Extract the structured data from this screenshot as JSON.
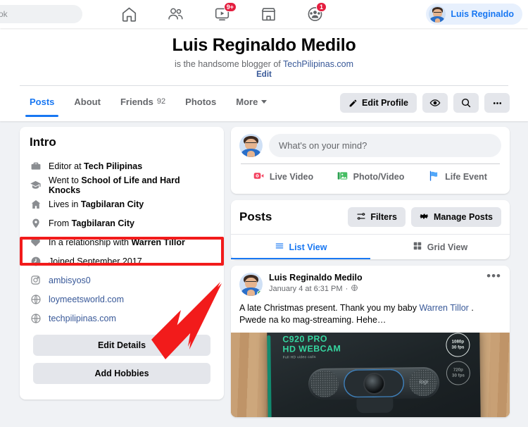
{
  "topnav": {
    "search_placeholder": "ok",
    "icons": [
      {
        "name": "home-icon",
        "label": "Home",
        "badge": ""
      },
      {
        "name": "friends-icon",
        "label": "Friends",
        "badge": ""
      },
      {
        "name": "watch-icon",
        "label": "Watch",
        "badge": "9+"
      },
      {
        "name": "marketplace-icon",
        "label": "Marketplace",
        "badge": ""
      },
      {
        "name": "groups-icon",
        "label": "Groups",
        "badge": "1"
      }
    ],
    "user_chip_name": "Luis Reginaldo"
  },
  "profile": {
    "name": "Luis Reginaldo Medilo",
    "bio_prefix": "is the handsome blogger of ",
    "bio_link": "TechPilipinas.com",
    "edit_label": "Edit",
    "tabs": [
      {
        "label": "Posts",
        "count": "",
        "active": true
      },
      {
        "label": "About",
        "count": "",
        "active": false
      },
      {
        "label": "Friends",
        "count": "92",
        "active": false
      },
      {
        "label": "Photos",
        "count": "",
        "active": false
      },
      {
        "label": "More",
        "count": "",
        "active": false
      }
    ],
    "actions": {
      "edit_profile": "Edit Profile",
      "view_as": "view-as-eye-icon",
      "search": "search-icon",
      "more": "more-options-icon"
    }
  },
  "intro": {
    "title": "Intro",
    "rows": [
      {
        "icon": "briefcase-icon",
        "prefix": "Editor at ",
        "bold": "Tech Pilipinas",
        "link": false
      },
      {
        "icon": "graduation-cap-icon",
        "prefix": "Went to ",
        "bold": "School of Life and Hard Knocks",
        "link": false
      },
      {
        "icon": "home-icon",
        "prefix": "Lives in ",
        "bold": "Tagbilaran City",
        "link": false
      },
      {
        "icon": "location-pin-icon",
        "prefix": "From ",
        "bold": "Tagbilaran City",
        "link": false
      },
      {
        "icon": "heart-icon",
        "prefix": "In a relationship with ",
        "bold": "Warren Tillor",
        "link": false
      },
      {
        "icon": "clock-icon",
        "prefix": "Joined September 2017",
        "bold": "",
        "link": false
      },
      {
        "icon": "instagram-icon",
        "prefix": "ambisyos0",
        "bold": "",
        "link": true
      },
      {
        "icon": "globe-icon",
        "prefix": "loymeetsworld.com",
        "bold": "",
        "link": true
      },
      {
        "icon": "globe-icon",
        "prefix": "techpilipinas.com",
        "bold": "",
        "link": true
      }
    ],
    "edit_details_label": "Edit Details",
    "add_hobbies_label": "Add Hobbies"
  },
  "composer": {
    "placeholder": "What's on your mind?",
    "actions": [
      {
        "label": "Live Video",
        "icon": "live-video-icon",
        "color": "#f3425f"
      },
      {
        "label": "Photo/Video",
        "icon": "photo-video-icon",
        "color": "#45bd62"
      },
      {
        "label": "Life Event",
        "icon": "life-event-icon",
        "color": "#1b74e4"
      }
    ]
  },
  "posts_section": {
    "title": "Posts",
    "filters_label": "Filters",
    "manage_label": "Manage Posts",
    "views": [
      {
        "label": "List View",
        "icon": "list-view-icon",
        "active": true
      },
      {
        "label": "Grid View",
        "icon": "grid-view-icon",
        "active": false
      }
    ]
  },
  "post": {
    "author": "Luis Reginaldo Medilo",
    "timestamp": "January 4 at 6:31 PM",
    "privacy_icon": "globe-icon",
    "text_before": "A late Christmas present. Thank you my baby ",
    "mention": "Warren Tillor",
    "text_after": " . Pwede na ko mag-streaming. Hehe…",
    "more_icon": "post-more-icon",
    "image": {
      "title_line1": "C920 PRO",
      "title_line2": "HD WEBCAM",
      "subtitle": "Full HD video calls",
      "badge1_line1": "1080p",
      "badge1_line2": "30 fps",
      "badge2_line1": "720p",
      "badge2_line2": "30 fps",
      "brand": "logi"
    }
  },
  "annotation": {
    "highlight_color": "#f21b1b",
    "target": "Edit Details"
  }
}
